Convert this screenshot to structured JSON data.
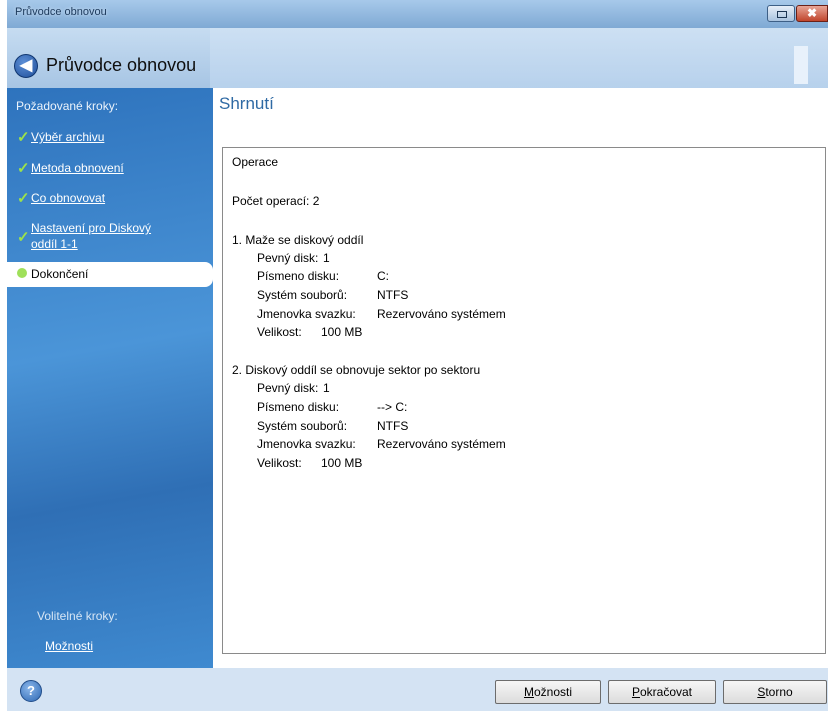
{
  "window": {
    "title": "Průvodce obnovou",
    "header_title": "Průvodce obnovou",
    "close_glyph": "✖",
    "back_glyph": "◀"
  },
  "sidebar": {
    "required_label": "Požadované kroky:",
    "steps": [
      {
        "label": "Výběr archivu",
        "status": "done"
      },
      {
        "label": "Metoda obnovení",
        "status": "done"
      },
      {
        "label": "Co obnovovat",
        "status": "done"
      },
      {
        "label_line1": "Nastavení pro Diskový",
        "label_line2": "oddíl 1-1",
        "status": "done"
      },
      {
        "label": "Dokončení",
        "status": "current"
      }
    ],
    "optional_label": "Volitelné kroky:",
    "optional_link": "Možnosti"
  },
  "main": {
    "title": "Shrnutí",
    "summary": {
      "heading": "Operace",
      "count": "Počet operací: 2",
      "op1": {
        "title": "1. Maže se diskový oddíl",
        "fields": [
          {
            "key": "Pevný disk:",
            "value": "1"
          },
          {
            "key": "Písmeno disku:",
            "value": "C:"
          },
          {
            "key": "Systém souborů:",
            "value": "NTFS"
          },
          {
            "key": "Jmenovka svazku:",
            "value": "Rezervováno systémem"
          },
          {
            "key": "Velikost:",
            "value": "100 MB"
          }
        ]
      },
      "op2": {
        "title": "2. Diskový oddíl se obnovuje sektor po sektoru",
        "fields": [
          {
            "key": "Pevný disk:",
            "value": "1"
          },
          {
            "key": "Písmeno disku:",
            "value": "--> C:"
          },
          {
            "key": "Systém souborů:",
            "value": "NTFS"
          },
          {
            "key": "Jmenovka svazku:",
            "value": "Rezervováno systémem"
          },
          {
            "key": "Velikost:",
            "value": "100 MB"
          }
        ]
      }
    }
  },
  "footer": {
    "help_glyph": "?",
    "options_first": "M",
    "options_rest": "ožnosti",
    "continue_first": "P",
    "continue_rest": "okračovat",
    "cancel_first": "S",
    "cancel_rest": "torno"
  }
}
